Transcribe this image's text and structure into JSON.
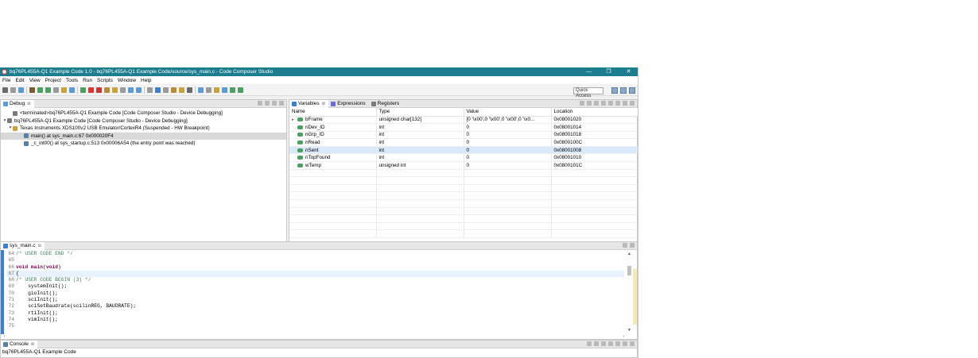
{
  "window": {
    "title": "bq76PL455A-Q1 Example Code 1.0 - bq76PL455A-Q1 Example Code/source/sys_main.c - Code Composer Studio",
    "minimize": "—",
    "restore": "❐",
    "close": "✕"
  },
  "menu": [
    "File",
    "Edit",
    "View",
    "Project",
    "Tools",
    "Run",
    "Scripts",
    "Window",
    "Help"
  ],
  "toolbar": {
    "quick_access": "Quick Access",
    "button_colors": [
      "#6b6b6b",
      "#9a9a9a",
      "#5a9bd5",
      "#7a5c2e",
      "#4a9f61",
      "#4a9f61",
      "#9a9a9a",
      "#c8a23a",
      "#5a9bd5",
      "#4a9f61",
      "#d33",
      "#c33",
      "#b58d3d",
      "#c8a23a",
      "#9a9a9a",
      "#5a9bd5",
      "#5a9bd5",
      "#9a9a9a",
      "#3a7fd3",
      "#9a9a9a",
      "#b58d3d",
      "#c8a23a",
      "#6b6b6b",
      "#5a9bd5",
      "#9a9a9a",
      "#c8a23a",
      "#5a9bd5",
      "#4a9f61",
      "#4a9f61"
    ]
  },
  "debug": {
    "tab": "Debug",
    "tab_close": "⊠",
    "tree": [
      {
        "indent": 1,
        "twisty": "",
        "icon_color": "#7a7a7a",
        "text": "<terminated>bq76PL455A-Q1 Example Code [Code Composer Studio - Device Debugging]",
        "selected": false
      },
      {
        "indent": 0,
        "twisty": "▾",
        "icon_color": "#7a7a7a",
        "text": "bq76PL455A-Q1 Example Code [Code Composer Studio - Device Debugging]",
        "selected": false
      },
      {
        "indent": 1,
        "twisty": "▾",
        "icon_color": "#c8a23a",
        "text": "Texas Instruments XDS100v2 USB Emulator/CortexR4 (Suspended - HW Breakpoint)",
        "selected": false
      },
      {
        "indent": 3,
        "twisty": "",
        "icon_color": "#5a7fa5",
        "text": "main() at sys_main.c:67 0x000020F4",
        "selected": true
      },
      {
        "indent": 3,
        "twisty": "",
        "icon_color": "#5a7fa5",
        "text": "_c_int00() at sys_startup.c:513 0x00006A54  (the entry point was reached)",
        "selected": false
      }
    ]
  },
  "variables": {
    "tabs": [
      {
        "label": "Variables",
        "color": "#3a7fd3",
        "active": true
      },
      {
        "label": "Expressions",
        "color": "#6b6bd6",
        "active": false
      },
      {
        "label": "Registers",
        "color": "#7a7a7a",
        "active": false
      }
    ],
    "tab_close": "⊠",
    "columns": [
      "Name",
      "Type",
      "Value",
      "Location"
    ],
    "rows": [
      {
        "expand": "▸",
        "name": "bFrame",
        "type": "unsigned char[132]",
        "value": "[0 '\\x00',0 '\\x00',0 '\\x00',0 '\\x0...",
        "location": "0x08001020",
        "selected": false
      },
      {
        "expand": "",
        "name": "nDev_ID",
        "type": "int",
        "value": "0",
        "location": "0x08001014",
        "selected": false
      },
      {
        "expand": "",
        "name": "nGrp_ID",
        "type": "int",
        "value": "0",
        "location": "0x08001018",
        "selected": false
      },
      {
        "expand": "",
        "name": "nRead",
        "type": "int",
        "value": "0",
        "location": "0x0800100C",
        "selected": false
      },
      {
        "expand": "",
        "name": "nSent",
        "type": "int",
        "value": "0",
        "location": "0x08001008",
        "selected": true
      },
      {
        "expand": "",
        "name": "nTopFound",
        "type": "int",
        "value": "0",
        "location": "0x08001010",
        "selected": false
      },
      {
        "expand": "",
        "name": "wTemp",
        "type": "unsigned int",
        "value": "0",
        "location": "0x0800101C",
        "selected": false
      }
    ],
    "empty_rows": 9
  },
  "editor": {
    "tab": "sys_main.c",
    "tab_close": "⊠",
    "lines": [
      {
        "num": "64",
        "parts": [
          {
            "c": "cmt",
            "t": "/* USER CODE END */"
          }
        ]
      },
      {
        "num": "65",
        "parts": []
      },
      {
        "num": "66",
        "marker": "⊖",
        "parts": [
          {
            "c": "kw",
            "t": "void"
          },
          {
            "c": "",
            "t": " "
          },
          {
            "c": "kw",
            "t": "main"
          },
          {
            "c": "",
            "t": "("
          },
          {
            "c": "kw",
            "t": "void"
          },
          {
            "c": "",
            "t": ")"
          }
        ]
      },
      {
        "num": "67",
        "current": true,
        "parts": [
          {
            "c": "",
            "t": "{"
          }
        ]
      },
      {
        "num": "68",
        "parts": [
          {
            "c": "cmt",
            "t": "/* USER CODE BEGIN (3) */"
          }
        ]
      },
      {
        "num": "69",
        "parts": [
          {
            "c": "",
            "t": "    systemInit();"
          }
        ]
      },
      {
        "num": "70",
        "parts": [
          {
            "c": "",
            "t": "    gioInit();"
          }
        ]
      },
      {
        "num": "71",
        "parts": [
          {
            "c": "",
            "t": "    sciInit();"
          }
        ]
      },
      {
        "num": "72",
        "parts": [
          {
            "c": "",
            "t": "    sciSetBaudrate(scilinREG, BAUDRATE);"
          }
        ]
      },
      {
        "num": "73",
        "parts": [
          {
            "c": "",
            "t": "    rtiInit();"
          }
        ]
      },
      {
        "num": "74",
        "parts": [
          {
            "c": "",
            "t": "    vimInit();"
          }
        ]
      },
      {
        "num": "75",
        "parts": []
      }
    ],
    "scroll_up": "▲",
    "scroll_down": "▼",
    "hscroll_left": "‹",
    "hscroll_right": "›"
  },
  "console": {
    "tab": "Console",
    "tab_close": "⊠",
    "text": "bq76PL455A-Q1 Example Code"
  }
}
